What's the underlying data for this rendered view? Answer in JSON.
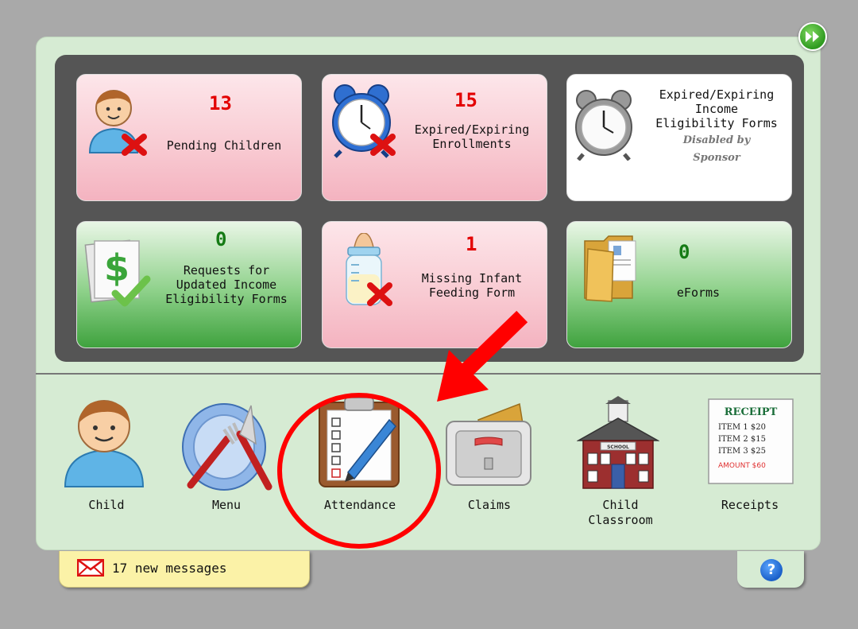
{
  "tiles": [
    {
      "number": "13",
      "label": "Pending Children"
    },
    {
      "number": "15",
      "label_lines": [
        "Expired/Expiring",
        "Enrollments"
      ]
    },
    {
      "label_lines": [
        "Expired/Expiring",
        "Income",
        "Eligibility Forms"
      ],
      "sub_lines": [
        "Disabled by",
        "Sponsor"
      ]
    },
    {
      "number": "0",
      "label_lines": [
        "Requests for",
        "Updated Income",
        "Eligibility Forms"
      ]
    },
    {
      "number": "1",
      "label_lines": [
        "Missing Infant",
        "Feeding Form"
      ]
    },
    {
      "number": "0",
      "label": "eForms"
    }
  ],
  "nav": {
    "child": "Child",
    "menu": "Menu",
    "attendance": "Attendance",
    "claims": "Claims",
    "classroom_line1": "Child",
    "classroom_line2": "Classroom",
    "receipts": "Receipts"
  },
  "receipt_icon": {
    "title": "RECEIPT",
    "lines": [
      "ITEM 1 $20",
      "ITEM 2 $15",
      "ITEM 3 $25"
    ],
    "total": "AMOUNT $60"
  },
  "school_sign": "SCHOOL",
  "messages": "17 new messages",
  "help": "?",
  "colors": {
    "background": "#a9a9a9",
    "panel": "#d6ebd3",
    "alert_red": "#e30000",
    "ok_green": "#157b15",
    "annotation_red": "#ff0000"
  },
  "icons": [
    "next-arrow-icon",
    "person-x-icon",
    "alarm-clock-x-icon",
    "alarm-clock-icon",
    "dollar-check-icon",
    "baby-bottle-x-icon",
    "folder-form-icon",
    "child-icon",
    "plate-fork-knife-icon",
    "clipboard-pencil-icon",
    "claims-drawer-icon",
    "schoolhouse-icon",
    "receipt-icon",
    "envelope-icon",
    "help-icon"
  ]
}
